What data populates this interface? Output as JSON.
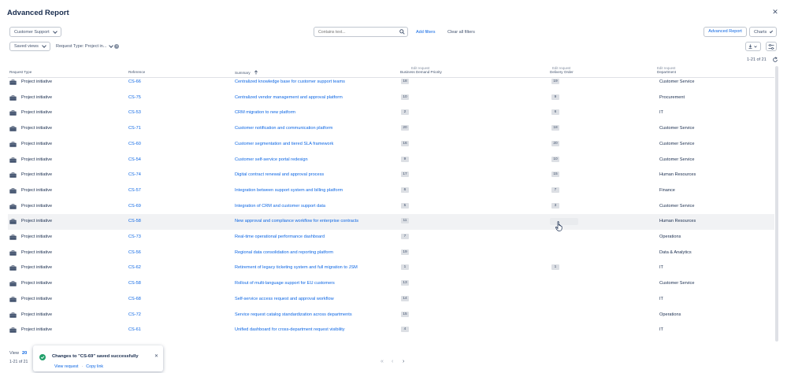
{
  "header": {
    "title": "Advanced Report",
    "close_icon": "close-icon"
  },
  "filters": {
    "project": "Customer Support",
    "search_placeholder": "Contains text...",
    "add_filters": "Add filters",
    "clear_filters": "Clear all filters",
    "saved_views": "Saved views",
    "request_type_pill": "Request Type: Project in..."
  },
  "actions": {
    "advanced_report": "Advanced Report",
    "charts": "Charts"
  },
  "result_count": "1-21 of 21",
  "columns": {
    "request_type": "Request Type",
    "reference": "Reference",
    "summary": "Summary",
    "bdp_edit": "Edit request",
    "bdp": "Business Demand Priority",
    "delivery_edit": "Edit request",
    "delivery": "Delivery Order",
    "dept_edit": "Edit request",
    "department": "Department"
  },
  "rows": [
    {
      "type": "Project initiative",
      "ref": "CS-66",
      "summary": "Centralized knowledge base for customer support teams",
      "bdp": "18",
      "delivery": "19",
      "dept": "Customer Service"
    },
    {
      "type": "Project initiative",
      "ref": "CS-75",
      "summary": "Centralized vendor management and approval platform",
      "bdp": "10",
      "delivery": "9",
      "dept": "Procurement"
    },
    {
      "type": "Project initiative",
      "ref": "CS-53",
      "summary": "CRM migration to new platform",
      "bdp": "2",
      "delivery": "6",
      "dept": "IT"
    },
    {
      "type": "Project initiative",
      "ref": "CS-71",
      "summary": "Customer notification and communication platform",
      "bdp": "20",
      "delivery": "18",
      "dept": "Customer Service"
    },
    {
      "type": "Project initiative",
      "ref": "CS-60",
      "summary": "Customer segmentation and tiered SLA framework",
      "bdp": "16",
      "delivery": "20",
      "dept": "Customer Service"
    },
    {
      "type": "Project initiative",
      "ref": "CS-54",
      "summary": "Customer self-service portal redesign",
      "bdp": "9",
      "delivery": "10",
      "dept": "Customer Service"
    },
    {
      "type": "Project initiative",
      "ref": "CS-74",
      "summary": "Digital contract renewal and approval process",
      "bdp": "17",
      "delivery": "15",
      "dept": "Human Resources"
    },
    {
      "type": "Project initiative",
      "ref": "CS-57",
      "summary": "Integration between support system and billing platform",
      "bdp": "6",
      "delivery": "7",
      "dept": "Finance"
    },
    {
      "type": "Project initiative",
      "ref": "CS-69",
      "summary": "Integration of CRM and customer support data",
      "bdp": "5",
      "delivery": "3",
      "dept": "Customer Service"
    },
    {
      "type": "Project initiative",
      "ref": "CS-58",
      "summary": "New approval and compliance workflow for enterprise contracts",
      "bdp": "11",
      "delivery": "",
      "dept": "Human Resources"
    },
    {
      "type": "Project initiative",
      "ref": "CS-73",
      "summary": "Real-time operational performance dashboard",
      "bdp": "7",
      "delivery": "",
      "dept": "Operations"
    },
    {
      "type": "Project initiative",
      "ref": "CS-56",
      "summary": "Regional data consolidation and reporting platform",
      "bdp": "19",
      "delivery": "",
      "dept": "Data & Analytics"
    },
    {
      "type": "Project initiative",
      "ref": "CS-62",
      "summary": "Retirement of legacy ticketing system and full migration to JSM",
      "bdp": "1",
      "delivery": "1",
      "dept": "IT"
    },
    {
      "type": "Project initiative",
      "ref": "CS-58",
      "summary": "Rollout of multi-language support for EU customers",
      "bdp": "13",
      "delivery": "",
      "dept": "Customer Service"
    },
    {
      "type": "Project initiative",
      "ref": "CS-68",
      "summary": "Self-service access request and approval workflow",
      "bdp": "14",
      "delivery": "",
      "dept": "IT"
    },
    {
      "type": "Project initiative",
      "ref": "CS-72",
      "summary": "Service request catalog standardization across departments",
      "bdp": "15",
      "delivery": "",
      "dept": "Operations"
    },
    {
      "type": "Project initiative",
      "ref": "CS-61",
      "summary": "Unified dashboard for cross-department request visibility",
      "bdp": "4",
      "delivery": "",
      "dept": "IT"
    }
  ],
  "footer": {
    "view_label": "View",
    "view_count": "20",
    "count": "1-21 of 21"
  },
  "toast": {
    "title": "Changes to \"CS-69\" saved successfully",
    "view_request": "View request",
    "sep": "·",
    "copy_link": "Copy link"
  },
  "pager": {
    "first": "«",
    "prev": "‹",
    "next": "›"
  },
  "colors": {
    "link": "#0c66e4",
    "success": "#22a06b",
    "badge": "#dcdfe4"
  }
}
